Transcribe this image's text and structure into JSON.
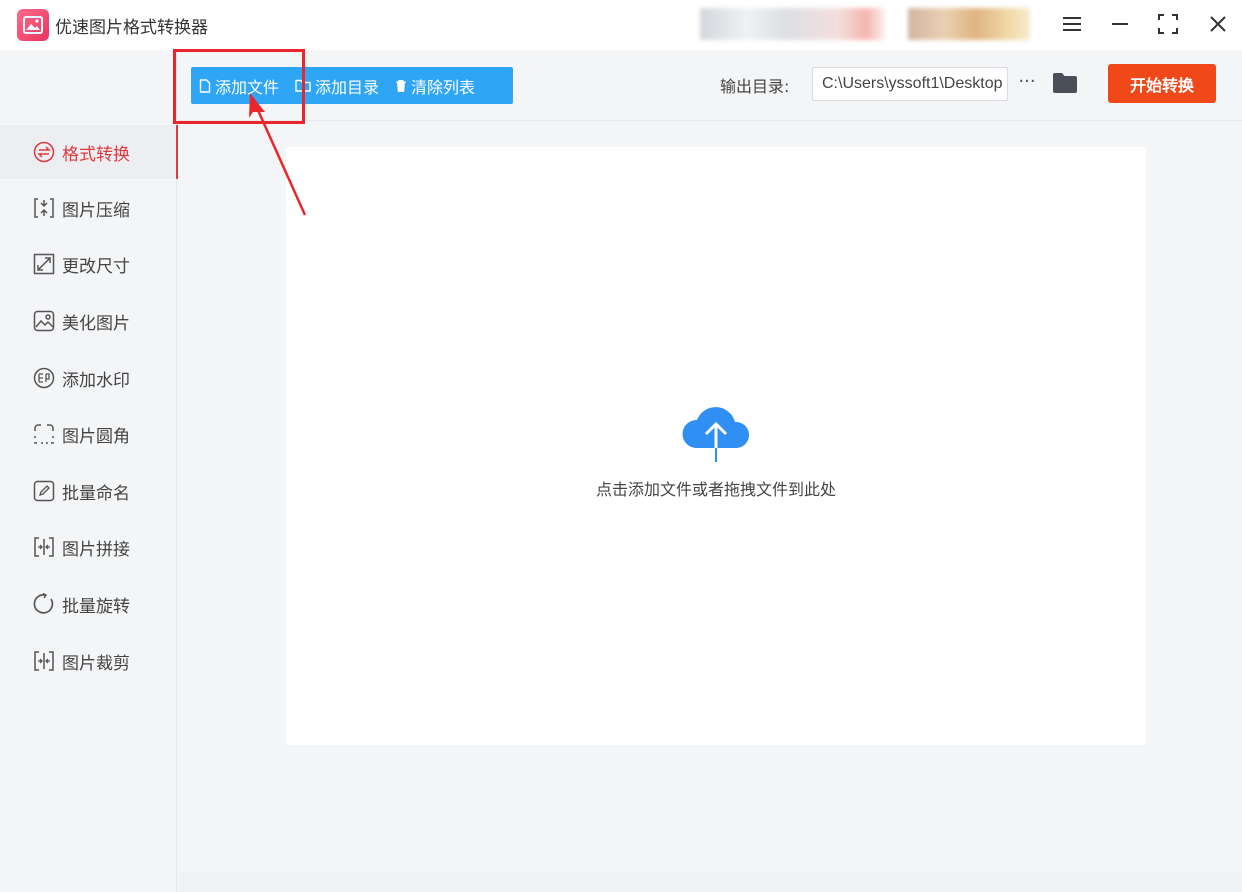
{
  "app": {
    "title": "优速图片格式转换器",
    "icon": "image-app-icon"
  },
  "window_controls": [
    "menu-icon",
    "minimize-icon",
    "maximize-icon",
    "close-icon"
  ],
  "sidebar": {
    "items": [
      {
        "label": "格式转换",
        "icon": "convert-icon",
        "active": true
      },
      {
        "label": "图片压缩",
        "icon": "compress-icon",
        "active": false
      },
      {
        "label": "更改尺寸",
        "icon": "resize-icon",
        "active": false
      },
      {
        "label": "美化图片",
        "icon": "beautify-icon",
        "active": false
      },
      {
        "label": "添加水印",
        "icon": "watermark-icon",
        "active": false
      },
      {
        "label": "图片圆角",
        "icon": "round-corner-icon",
        "active": false
      },
      {
        "label": "批量命名",
        "icon": "rename-icon",
        "active": false
      },
      {
        "label": "图片拼接",
        "icon": "stitch-icon",
        "active": false
      },
      {
        "label": "批量旋转",
        "icon": "rotate-icon",
        "active": false
      },
      {
        "label": "图片裁剪",
        "icon": "crop-icon",
        "active": false
      }
    ]
  },
  "toolbar": {
    "add_file_label": "添加文件",
    "add_dir_label": "添加目录",
    "clear_list_label": "清除列表",
    "output_dir_label": "输出目录:",
    "output_dir_value": "C:\\Users\\yssoft1\\Desktop",
    "more_label": "···",
    "start_label": "开始转换"
  },
  "dropzone": {
    "hint": "点击添加文件或者拖拽文件到此处",
    "icon": "cloud-upload-icon"
  },
  "colors": {
    "accent_blue": "#2fa5f5",
    "start_red": "#f04818",
    "active_red": "#e0393e",
    "annotation_red": "#e8262b"
  }
}
